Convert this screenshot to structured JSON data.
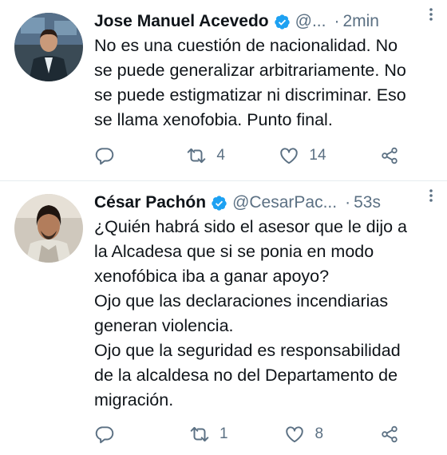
{
  "tweets": [
    {
      "name": "Jose Manuel Acevedo",
      "handle": "@...",
      "dot": "·",
      "time": "2min",
      "text": "No es una cuestión de nacionalidad. No\nse puede generalizar arbitrariamente. No\nse puede estigmatizar ni discriminar. Eso\nse llama xenofobia. Punto final.",
      "replies": "",
      "retweets": "4",
      "likes": "14"
    },
    {
      "name": "César Pachón",
      "handle": "@CesarPac...",
      "dot": "·",
      "time": "53s",
      "text": "¿Quién habrá sido el asesor que le dijo a\nla Alcadesa que si se ponia en modo\nxenofóbica iba a ganar apoyo?\nOjo que las declaraciones incendiarias\ngeneran violencia.\nOjo que la seguridad es responsabilidad\nde la alcaldesa no del Departamento de\nmigración.",
      "replies": "",
      "retweets": "1",
      "likes": "8"
    }
  ],
  "icons": {
    "reply": "reply-icon",
    "retweet": "retweet-icon",
    "like": "heart-icon",
    "share": "share-icon",
    "verified": "verified-badge-icon",
    "more": "more-vertical-icon"
  },
  "colors": {
    "verified": "#1da1f2",
    "secondary_text": "#5b7083",
    "divider": "#e6ecf0"
  }
}
